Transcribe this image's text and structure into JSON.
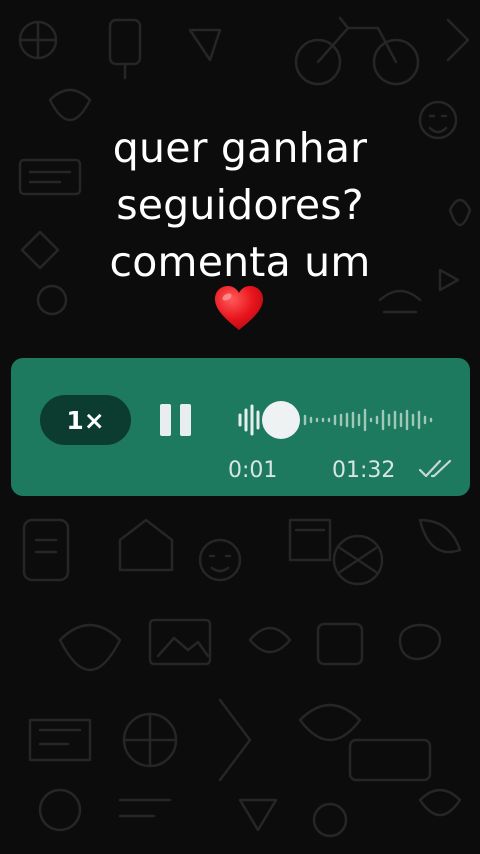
{
  "caption": {
    "lines": [
      "quer ganhar",
      "seguidores?",
      "comenta um"
    ],
    "emoji": "heart"
  },
  "voice_message": {
    "speed_label": "1×",
    "state": "playing",
    "progress": 0.01,
    "current_time": "0:01",
    "duration": "01:32",
    "status": "read",
    "colors": {
      "bubble": "#1e7a5f",
      "speed_pill": "#0c3b30",
      "text": "#d7e6e0",
      "background": "#0c0c0c"
    }
  }
}
